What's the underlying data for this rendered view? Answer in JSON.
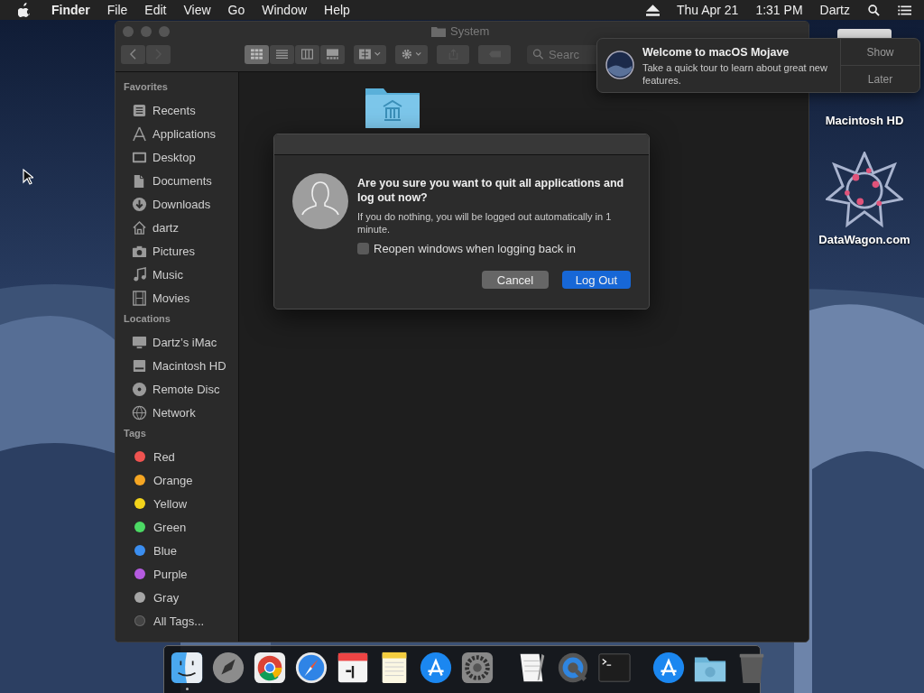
{
  "menu_bar": {
    "app": "Finder",
    "menus": [
      "File",
      "Edit",
      "View",
      "Go",
      "Window",
      "Help"
    ],
    "date": "Thu Apr 21",
    "time": "1:31 PM",
    "user": "Dartz"
  },
  "finder": {
    "title": "System",
    "view_buttons": [
      {
        "selected": true
      },
      {
        "selected": false
      },
      {
        "selected": false
      },
      {
        "selected": false
      }
    ],
    "search": {
      "placeholder": "Searc"
    },
    "sidebar": [
      {
        "heading": "Favorites",
        "items": [
          {
            "label": "Recents"
          },
          {
            "label": "Applications"
          },
          {
            "label": "Desktop"
          },
          {
            "label": "Documents"
          },
          {
            "label": "Downloads"
          },
          {
            "label": "dartz"
          },
          {
            "label": "Pictures"
          },
          {
            "label": "Music"
          },
          {
            "label": "Movies"
          }
        ]
      },
      {
        "heading": "Locations",
        "items": [
          {
            "label": "Dartz’s iMac"
          },
          {
            "label": "Macintosh HD"
          },
          {
            "label": "Remote Disc"
          },
          {
            "label": "Network"
          }
        ]
      },
      {
        "heading": "Tags",
        "items": [
          {
            "label": "Red",
            "color": "#ef5350"
          },
          {
            "label": "Orange",
            "color": "#f5a623"
          },
          {
            "label": "Yellow",
            "color": "#f3d31b"
          },
          {
            "label": "Green",
            "color": "#4cd964"
          },
          {
            "label": "Blue",
            "color": "#3b8ef0"
          },
          {
            "label": "Purple",
            "color": "#b55be0"
          },
          {
            "label": "Gray",
            "color": "#a6a6a6"
          },
          {
            "label": "All Tags..."
          }
        ]
      }
    ]
  },
  "dialog": {
    "title": "Are you sure you want to quit all applications and log out now?",
    "message": "If you do nothing, you will be logged out automatically in 1 minute.",
    "checkbox": {
      "label": "Reopen windows when logging back in",
      "checked": false
    },
    "buttons": [
      {
        "label": "Cancel",
        "kind": "secondary"
      },
      {
        "label": "Log Out",
        "kind": "primary"
      }
    ]
  },
  "notification": {
    "title": "Welcome to macOS Mojave",
    "body": "Take a quick tour to learn about great new features.",
    "actions": [
      "Show",
      "Later"
    ]
  },
  "desktop_icons": [
    {
      "label": "Macintosh HD"
    },
    {
      "label": "DataWagon.com"
    }
  ],
  "dock": [
    {
      "running": true
    },
    {
      "running": false
    },
    {
      "running": false
    },
    {
      "running": false
    },
    {
      "running": false
    },
    {
      "running": false
    },
    {
      "running": false
    },
    {
      "running": false
    },
    {
      "running": false
    },
    {
      "running": false
    },
    {
      "running": false
    },
    {
      "running": false
    },
    {
      "running": false
    },
    {
      "running": false
    }
  ]
}
